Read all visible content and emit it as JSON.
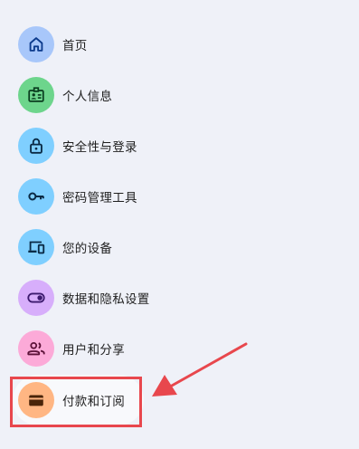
{
  "nav": {
    "items": [
      {
        "label": "首页",
        "icon": "home-icon",
        "color": "#a8c7fa"
      },
      {
        "label": "个人信息",
        "icon": "id-card-icon",
        "color": "#6dd58c"
      },
      {
        "label": "安全性与登录",
        "icon": "lock-icon",
        "color": "#7fcfff"
      },
      {
        "label": "密码管理工具",
        "icon": "key-icon",
        "color": "#7fcfff"
      },
      {
        "label": "您的设备",
        "icon": "devices-icon",
        "color": "#7fcfff"
      },
      {
        "label": "数据和隐私设置",
        "icon": "toggle-icon",
        "color": "#d7aefb"
      },
      {
        "label": "用户和分享",
        "icon": "people-icon",
        "color": "#fcaad8"
      },
      {
        "label": "付款和订阅",
        "icon": "wallet-icon",
        "color": "#ffb683"
      }
    ],
    "active_index": 7
  },
  "annotation": {
    "highlight_color": "#e8474d"
  }
}
